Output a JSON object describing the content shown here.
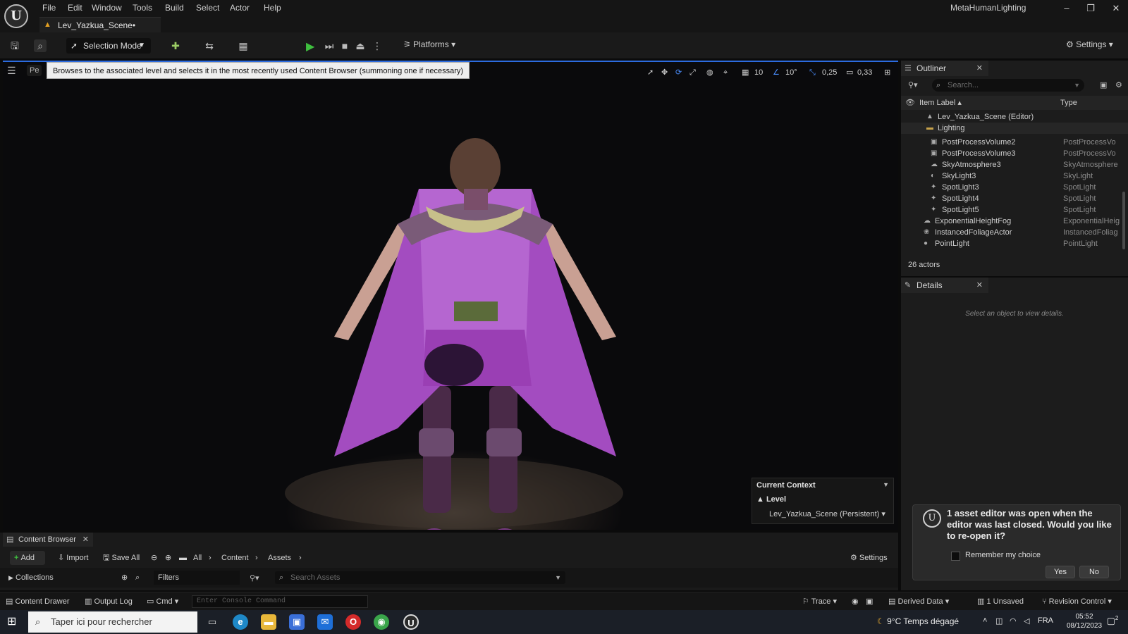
{
  "titlebar": {
    "menu": [
      "File",
      "Edit",
      "Window",
      "Tools",
      "Build",
      "Select",
      "Actor",
      "Help"
    ],
    "level_tab": "Lev_Yazkua_Scene•",
    "project_name": "MetaHumanLighting"
  },
  "toolbar": {
    "selection_mode": "Selection Mode",
    "platforms": "Platforms",
    "settings": "Settings"
  },
  "viewport": {
    "tooltip": "Browses to the associated level and selects it in the most recently used Content Browser (summoning one if necessary)",
    "perspective_label": "Pe",
    "grid_snap": "10",
    "rotation_snap": "10°",
    "scale_snap": "0,25",
    "camera_speed": "0,33",
    "current_context": {
      "header": "Current Context",
      "level_label": "Level",
      "level_value": "Lev_Yazkua_Scene (Persistent)"
    }
  },
  "outliner": {
    "tab_label": "Outliner",
    "search_placeholder": "Search...",
    "col_item_label": "Item Label",
    "col_type": "Type",
    "rows": [
      {
        "name": "Lev_Yazkua_Scene (Editor)",
        "type": ""
      },
      {
        "name": "Lighting",
        "type": ""
      },
      {
        "name": "PostProcessVolume2",
        "type": "PostProcessVo"
      },
      {
        "name": "PostProcessVolume3",
        "type": "PostProcessVo"
      },
      {
        "name": "SkyAtmosphere3",
        "type": "SkyAtmosphere"
      },
      {
        "name": "SkyLight3",
        "type": "SkyLight"
      },
      {
        "name": "SpotLight3",
        "type": "SpotLight"
      },
      {
        "name": "SpotLight4",
        "type": "SpotLight"
      },
      {
        "name": "SpotLight5",
        "type": "SpotLight"
      },
      {
        "name": "ExponentialHeightFog",
        "type": "ExponentialHeig"
      },
      {
        "name": "InstancedFoliageActor",
        "type": "InstancedFoliag"
      },
      {
        "name": "PointLight",
        "type": "PointLight"
      }
    ],
    "actor_count": "26 actors"
  },
  "details": {
    "tab_label": "Details",
    "empty_message": "Select an object to view details."
  },
  "toast": {
    "message": "1 asset editor was open when the editor was last closed. Would you like to re-open it?",
    "checkbox_label": "Remember my choice",
    "yes": "Yes",
    "no": "No"
  },
  "content_browser": {
    "tab_label": "Content Browser",
    "add": "Add",
    "import": "Import",
    "save_all": "Save All",
    "breadcrumbs": [
      "All",
      "Content",
      "Assets"
    ],
    "settings": "Settings",
    "collections": "Collections",
    "filters": "Filters",
    "search_placeholder": "Search Assets"
  },
  "statusbar": {
    "content_drawer": "Content Drawer",
    "output_log": "Output Log",
    "cmd": "Cmd",
    "console_placeholder": "Enter Console Command",
    "trace": "Trace",
    "derived_data": "Derived Data",
    "unsaved": "1 Unsaved",
    "revision_control": "Revision Control"
  },
  "taskbar": {
    "search_placeholder": "Taper ici pour rechercher",
    "weather": "9°C  Temps dégagé",
    "lang": "FRA",
    "time": "05:52",
    "date": "08/12/2023",
    "notif_count": "2"
  },
  "colors": {
    "accent_blue": "#2c6bdf",
    "play_green": "#3fbf3f",
    "warning_orange": "#e3a022",
    "character_purple": "#a34cc0"
  }
}
